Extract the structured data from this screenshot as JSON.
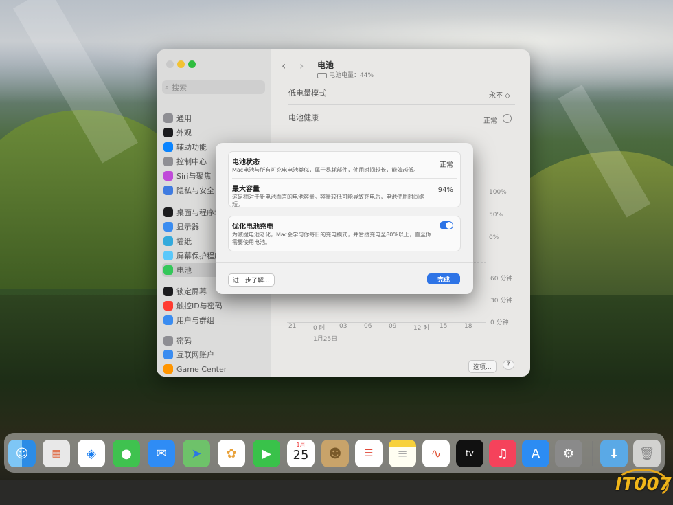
{
  "sidebar": {
    "search_placeholder": "搜索",
    "items": [
      {
        "label": "通用",
        "color": "#8e8e93"
      },
      {
        "label": "外观",
        "color": "#1c1c1e"
      },
      {
        "label": "辅助功能",
        "color": "#0a84ff"
      },
      {
        "label": "控制中心",
        "color": "#8e8e93"
      },
      {
        "label": "Siri与聚焦",
        "color": "#c04ad9"
      },
      {
        "label": "隐私与安全",
        "color": "#3f7be0"
      },
      {
        "label": "桌面与程序坞",
        "color": "#1c1c1e"
      },
      {
        "label": "显示器",
        "color": "#3a8cf0"
      },
      {
        "label": "墙纸",
        "color": "#34aadc"
      },
      {
        "label": "屏幕保护程序",
        "color": "#5ac8fa"
      },
      {
        "label": "电池",
        "color": "#34c759"
      },
      {
        "label": "锁定屏幕",
        "color": "#1c1c1e"
      },
      {
        "label": "触控ID与密码",
        "color": "#ff3b30"
      },
      {
        "label": "用户与群组",
        "color": "#3a8cf0"
      },
      {
        "label": "密码",
        "color": "#8e8e93"
      },
      {
        "label": "互联网账户",
        "color": "#3a8cf0"
      },
      {
        "label": "Game Center",
        "color": "#ff9500"
      }
    ]
  },
  "header": {
    "title": "电池",
    "subtitle": "电池电量：44%"
  },
  "settings": {
    "low_power_label": "低电量模式",
    "low_power_value": "永不 ◇",
    "health_label": "电池健康",
    "health_value": "正常"
  },
  "chart_axis": {
    "y_right_pct": [
      "100%",
      "50%",
      "0%"
    ],
    "y_right_min": [
      "60 分钟",
      "30 分钟",
      "0 分钟"
    ],
    "x_ticks": [
      "21",
      "0 时",
      "03",
      "06",
      "09",
      "12 时",
      "15",
      "18"
    ],
    "date": "1月25日"
  },
  "footer": {
    "options_label": "选项...",
    "help_label": "?"
  },
  "dialog": {
    "state_title": "电池状态",
    "state_desc": "Mac电池与所有可充电电池类似，属于易耗部件，使用时间越长，能效越低。",
    "state_value": "正常",
    "capacity_title": "最大容量",
    "capacity_desc": "这是相对于新电池而言的电池容量。容量较低可能导致充电后，电池使用时间缩短。",
    "capacity_value": "94%",
    "optimize_title": "优化电池充电",
    "optimize_desc": "为减缓电池老化，Mac会学习你每日的充电模式，并暂缓充电至80%以上，直至你需要使用电池。",
    "optimize_on": true,
    "learn_more": "进一步了解...",
    "done": "完成"
  },
  "dock": {
    "calendar_month": "1月",
    "calendar_day": "25",
    "tv_label": "tv"
  },
  "watermark": "IT007"
}
